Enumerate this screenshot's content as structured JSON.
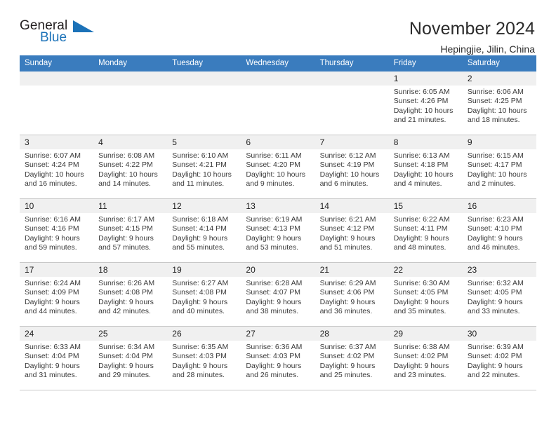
{
  "brand": {
    "name_part1": "General",
    "name_part2": "Blue",
    "accent_color": "#1b72b8",
    "logo_icon": "triangle-flag-icon"
  },
  "header": {
    "title": "November 2024",
    "subtitle": "Hepingjie, Jilin, China"
  },
  "theme": {
    "header_bg": "#3a7cbe",
    "daynum_bg": "#f0f0f0",
    "grid_line": "#c8c8c8",
    "text": "#3a3a3a"
  },
  "calendar": {
    "weekday_headers": [
      "Sunday",
      "Monday",
      "Tuesday",
      "Wednesday",
      "Thursday",
      "Friday",
      "Saturday"
    ],
    "weeks": [
      [
        {
          "day": "",
          "lines": []
        },
        {
          "day": "",
          "lines": []
        },
        {
          "day": "",
          "lines": []
        },
        {
          "day": "",
          "lines": []
        },
        {
          "day": "",
          "lines": []
        },
        {
          "day": "1",
          "lines": [
            "Sunrise: 6:05 AM",
            "Sunset: 4:26 PM",
            "Daylight: 10 hours",
            "and 21 minutes."
          ]
        },
        {
          "day": "2",
          "lines": [
            "Sunrise: 6:06 AM",
            "Sunset: 4:25 PM",
            "Daylight: 10 hours",
            "and 18 minutes."
          ]
        }
      ],
      [
        {
          "day": "3",
          "lines": [
            "Sunrise: 6:07 AM",
            "Sunset: 4:24 PM",
            "Daylight: 10 hours",
            "and 16 minutes."
          ]
        },
        {
          "day": "4",
          "lines": [
            "Sunrise: 6:08 AM",
            "Sunset: 4:22 PM",
            "Daylight: 10 hours",
            "and 14 minutes."
          ]
        },
        {
          "day": "5",
          "lines": [
            "Sunrise: 6:10 AM",
            "Sunset: 4:21 PM",
            "Daylight: 10 hours",
            "and 11 minutes."
          ]
        },
        {
          "day": "6",
          "lines": [
            "Sunrise: 6:11 AM",
            "Sunset: 4:20 PM",
            "Daylight: 10 hours",
            "and 9 minutes."
          ]
        },
        {
          "day": "7",
          "lines": [
            "Sunrise: 6:12 AM",
            "Sunset: 4:19 PM",
            "Daylight: 10 hours",
            "and 6 minutes."
          ]
        },
        {
          "day": "8",
          "lines": [
            "Sunrise: 6:13 AM",
            "Sunset: 4:18 PM",
            "Daylight: 10 hours",
            "and 4 minutes."
          ]
        },
        {
          "day": "9",
          "lines": [
            "Sunrise: 6:15 AM",
            "Sunset: 4:17 PM",
            "Daylight: 10 hours",
            "and 2 minutes."
          ]
        }
      ],
      [
        {
          "day": "10",
          "lines": [
            "Sunrise: 6:16 AM",
            "Sunset: 4:16 PM",
            "Daylight: 9 hours",
            "and 59 minutes."
          ]
        },
        {
          "day": "11",
          "lines": [
            "Sunrise: 6:17 AM",
            "Sunset: 4:15 PM",
            "Daylight: 9 hours",
            "and 57 minutes."
          ]
        },
        {
          "day": "12",
          "lines": [
            "Sunrise: 6:18 AM",
            "Sunset: 4:14 PM",
            "Daylight: 9 hours",
            "and 55 minutes."
          ]
        },
        {
          "day": "13",
          "lines": [
            "Sunrise: 6:19 AM",
            "Sunset: 4:13 PM",
            "Daylight: 9 hours",
            "and 53 minutes."
          ]
        },
        {
          "day": "14",
          "lines": [
            "Sunrise: 6:21 AM",
            "Sunset: 4:12 PM",
            "Daylight: 9 hours",
            "and 51 minutes."
          ]
        },
        {
          "day": "15",
          "lines": [
            "Sunrise: 6:22 AM",
            "Sunset: 4:11 PM",
            "Daylight: 9 hours",
            "and 48 minutes."
          ]
        },
        {
          "day": "16",
          "lines": [
            "Sunrise: 6:23 AM",
            "Sunset: 4:10 PM",
            "Daylight: 9 hours",
            "and 46 minutes."
          ]
        }
      ],
      [
        {
          "day": "17",
          "lines": [
            "Sunrise: 6:24 AM",
            "Sunset: 4:09 PM",
            "Daylight: 9 hours",
            "and 44 minutes."
          ]
        },
        {
          "day": "18",
          "lines": [
            "Sunrise: 6:26 AM",
            "Sunset: 4:08 PM",
            "Daylight: 9 hours",
            "and 42 minutes."
          ]
        },
        {
          "day": "19",
          "lines": [
            "Sunrise: 6:27 AM",
            "Sunset: 4:08 PM",
            "Daylight: 9 hours",
            "and 40 minutes."
          ]
        },
        {
          "day": "20",
          "lines": [
            "Sunrise: 6:28 AM",
            "Sunset: 4:07 PM",
            "Daylight: 9 hours",
            "and 38 minutes."
          ]
        },
        {
          "day": "21",
          "lines": [
            "Sunrise: 6:29 AM",
            "Sunset: 4:06 PM",
            "Daylight: 9 hours",
            "and 36 minutes."
          ]
        },
        {
          "day": "22",
          "lines": [
            "Sunrise: 6:30 AM",
            "Sunset: 4:05 PM",
            "Daylight: 9 hours",
            "and 35 minutes."
          ]
        },
        {
          "day": "23",
          "lines": [
            "Sunrise: 6:32 AM",
            "Sunset: 4:05 PM",
            "Daylight: 9 hours",
            "and 33 minutes."
          ]
        }
      ],
      [
        {
          "day": "24",
          "lines": [
            "Sunrise: 6:33 AM",
            "Sunset: 4:04 PM",
            "Daylight: 9 hours",
            "and 31 minutes."
          ]
        },
        {
          "day": "25",
          "lines": [
            "Sunrise: 6:34 AM",
            "Sunset: 4:04 PM",
            "Daylight: 9 hours",
            "and 29 minutes."
          ]
        },
        {
          "day": "26",
          "lines": [
            "Sunrise: 6:35 AM",
            "Sunset: 4:03 PM",
            "Daylight: 9 hours",
            "and 28 minutes."
          ]
        },
        {
          "day": "27",
          "lines": [
            "Sunrise: 6:36 AM",
            "Sunset: 4:03 PM",
            "Daylight: 9 hours",
            "and 26 minutes."
          ]
        },
        {
          "day": "28",
          "lines": [
            "Sunrise: 6:37 AM",
            "Sunset: 4:02 PM",
            "Daylight: 9 hours",
            "and 25 minutes."
          ]
        },
        {
          "day": "29",
          "lines": [
            "Sunrise: 6:38 AM",
            "Sunset: 4:02 PM",
            "Daylight: 9 hours",
            "and 23 minutes."
          ]
        },
        {
          "day": "30",
          "lines": [
            "Sunrise: 6:39 AM",
            "Sunset: 4:02 PM",
            "Daylight: 9 hours",
            "and 22 minutes."
          ]
        }
      ]
    ]
  }
}
